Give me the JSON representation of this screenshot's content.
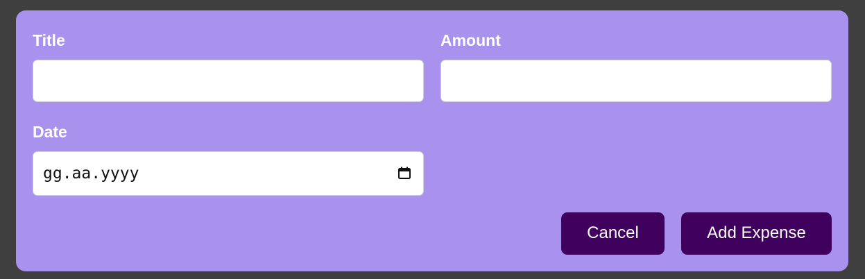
{
  "form": {
    "title_label": "Title",
    "title_value": "",
    "amount_label": "Amount",
    "amount_value": "",
    "date_label": "Date",
    "date_placeholder": "gg.aa.yyyy",
    "date_icon": "calendar-icon",
    "cancel_label": "Cancel",
    "submit_label": "Add Expense"
  },
  "colors": {
    "page_background": "#3f3f3f",
    "form_background": "#a892ee",
    "button_background": "#40005d",
    "label_text": "#ffffff"
  }
}
